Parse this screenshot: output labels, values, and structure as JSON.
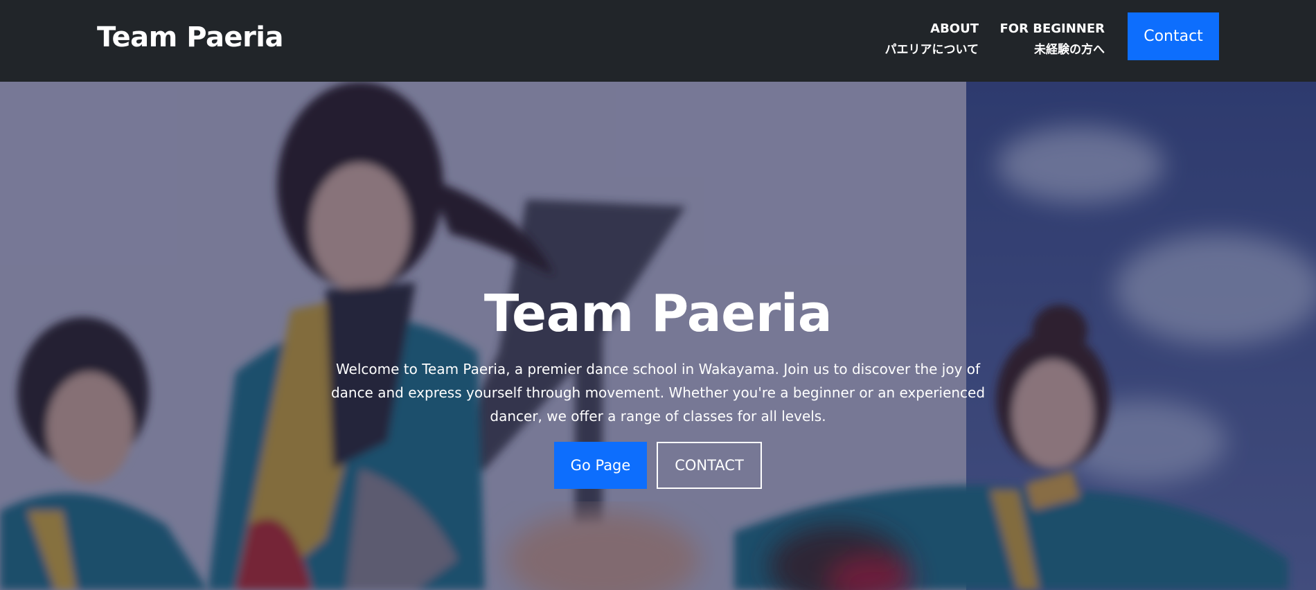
{
  "navbar": {
    "brand": "Team Paeria",
    "links": [
      {
        "en": "ABOUT",
        "ja": "パエリアについて"
      },
      {
        "en": "FOR BEGINNER",
        "ja": "未経験の方へ"
      }
    ],
    "contact_label": "Contact"
  },
  "hero": {
    "title": "Team Paeria",
    "lead": "Welcome to Team Paeria, a premier dance school in Wakayama. Join us to discover the joy of dance and express yourself through movement. Whether you're a beginner or an experienced dancer, we offer a range of classes for all levels.",
    "primary_button": "Go Page",
    "secondary_button": "CONTACT"
  },
  "colors": {
    "navbar_bg": "#212529",
    "primary": "#0d6efd",
    "text": "#ffffff"
  }
}
